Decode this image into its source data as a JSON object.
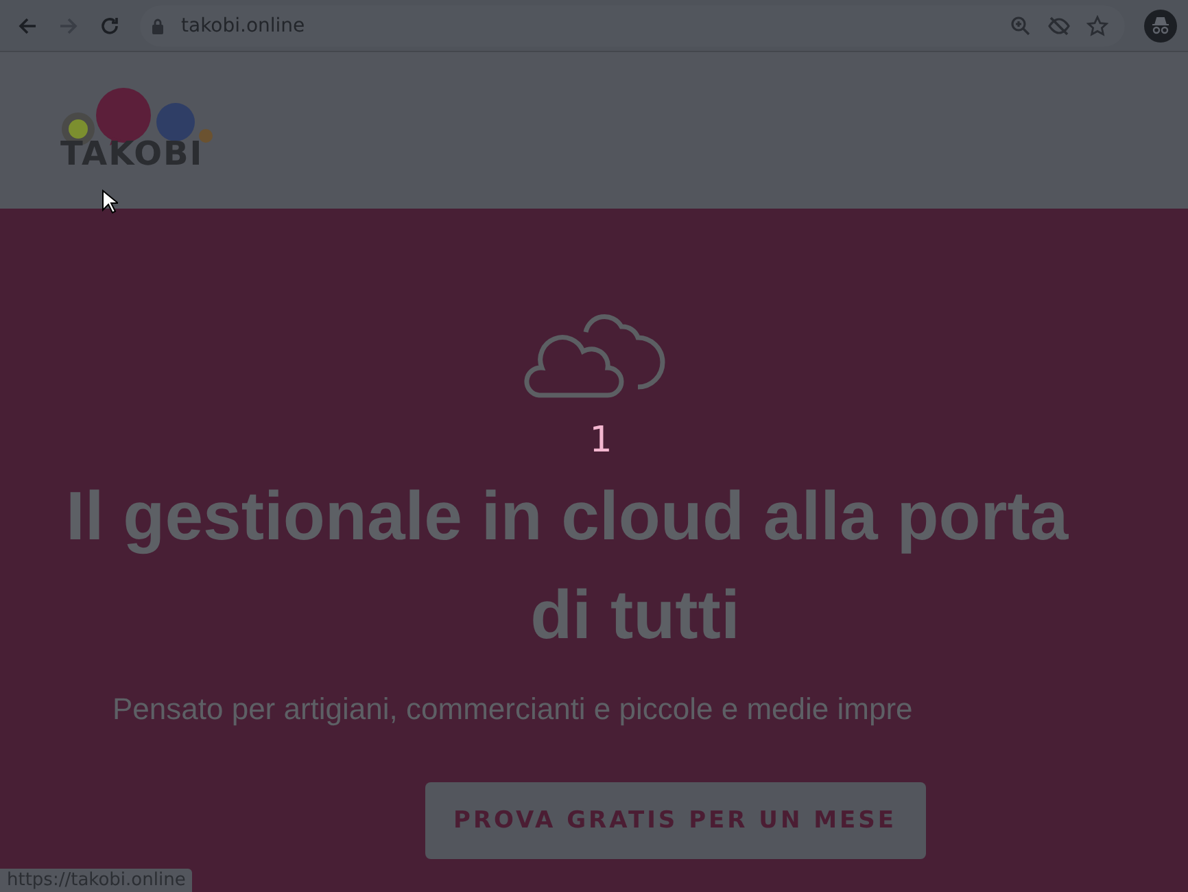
{
  "browser": {
    "url": "takobi.online"
  },
  "logo": {
    "text": "TAKOBI"
  },
  "hero": {
    "counter": "1",
    "title_lines": [
      "Il gestionale in cloud alla porta",
      "di tutti"
    ],
    "subtitle": "Pensato per artigiani, commercianti e piccole e medie impre",
    "cta": "PROVA GRATIS PER UN MESE"
  },
  "status_bar": {
    "url": "https://takobi.online"
  }
}
